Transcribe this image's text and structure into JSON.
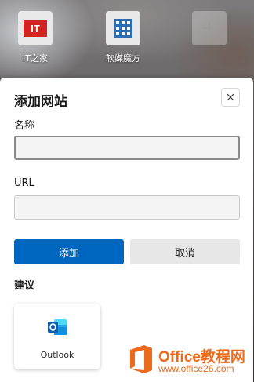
{
  "top_sites": [
    {
      "label": "IT之家",
      "icon": "it-home-logo"
    },
    {
      "label": "软媒魔方",
      "icon": "grid-app-icon"
    },
    {
      "label": "",
      "icon": "plus-icon"
    }
  ],
  "dialog": {
    "title": "添加网站",
    "close_icon": "close-icon",
    "name_label": "名称",
    "name_value": "",
    "url_label": "URL",
    "url_value": "",
    "add_label": "添加",
    "cancel_label": "取消",
    "suggestions_label": "建议",
    "suggestions": [
      {
        "label": "Outlook",
        "icon": "outlook-icon"
      }
    ]
  },
  "watermark": {
    "title": "Office教程网",
    "url": "www.office26.com"
  },
  "colors": {
    "primary": "#0067c0",
    "watermark": "#ec6a1c",
    "it_home_red": "#d22222",
    "magic_cube_blue": "#2e6db4"
  }
}
